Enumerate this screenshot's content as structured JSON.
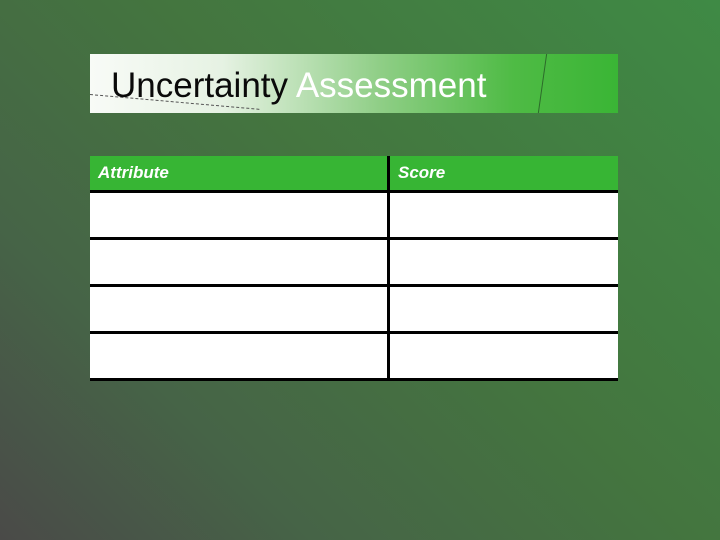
{
  "title": {
    "part1": "Uncertainty",
    "part2": "Assessment"
  },
  "table": {
    "headers": [
      "Attribute",
      "Score"
    ],
    "rows": [
      [
        "",
        ""
      ],
      [
        "",
        ""
      ],
      [
        "",
        ""
      ],
      [
        "",
        ""
      ]
    ]
  },
  "colors": {
    "header_bg": "#37b534",
    "background": "#44753f"
  }
}
